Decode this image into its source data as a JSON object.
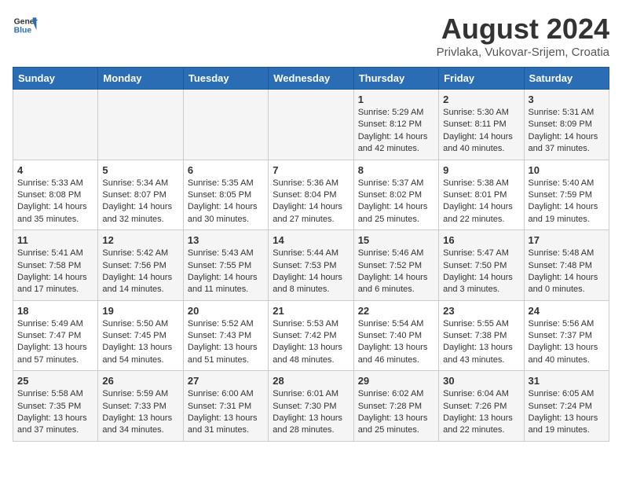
{
  "logo": {
    "text_general": "General",
    "text_blue": "Blue"
  },
  "title": "August 2024",
  "subtitle": "Privlaka, Vukovar-Srijem, Croatia",
  "days_of_week": [
    "Sunday",
    "Monday",
    "Tuesday",
    "Wednesday",
    "Thursday",
    "Friday",
    "Saturday"
  ],
  "weeks": [
    [
      {
        "day": "",
        "info": ""
      },
      {
        "day": "",
        "info": ""
      },
      {
        "day": "",
        "info": ""
      },
      {
        "day": "",
        "info": ""
      },
      {
        "day": "1",
        "info": "Sunrise: 5:29 AM\nSunset: 8:12 PM\nDaylight: 14 hours and 42 minutes."
      },
      {
        "day": "2",
        "info": "Sunrise: 5:30 AM\nSunset: 8:11 PM\nDaylight: 14 hours and 40 minutes."
      },
      {
        "day": "3",
        "info": "Sunrise: 5:31 AM\nSunset: 8:09 PM\nDaylight: 14 hours and 37 minutes."
      }
    ],
    [
      {
        "day": "4",
        "info": "Sunrise: 5:33 AM\nSunset: 8:08 PM\nDaylight: 14 hours and 35 minutes."
      },
      {
        "day": "5",
        "info": "Sunrise: 5:34 AM\nSunset: 8:07 PM\nDaylight: 14 hours and 32 minutes."
      },
      {
        "day": "6",
        "info": "Sunrise: 5:35 AM\nSunset: 8:05 PM\nDaylight: 14 hours and 30 minutes."
      },
      {
        "day": "7",
        "info": "Sunrise: 5:36 AM\nSunset: 8:04 PM\nDaylight: 14 hours and 27 minutes."
      },
      {
        "day": "8",
        "info": "Sunrise: 5:37 AM\nSunset: 8:02 PM\nDaylight: 14 hours and 25 minutes."
      },
      {
        "day": "9",
        "info": "Sunrise: 5:38 AM\nSunset: 8:01 PM\nDaylight: 14 hours and 22 minutes."
      },
      {
        "day": "10",
        "info": "Sunrise: 5:40 AM\nSunset: 7:59 PM\nDaylight: 14 hours and 19 minutes."
      }
    ],
    [
      {
        "day": "11",
        "info": "Sunrise: 5:41 AM\nSunset: 7:58 PM\nDaylight: 14 hours and 17 minutes."
      },
      {
        "day": "12",
        "info": "Sunrise: 5:42 AM\nSunset: 7:56 PM\nDaylight: 14 hours and 14 minutes."
      },
      {
        "day": "13",
        "info": "Sunrise: 5:43 AM\nSunset: 7:55 PM\nDaylight: 14 hours and 11 minutes."
      },
      {
        "day": "14",
        "info": "Sunrise: 5:44 AM\nSunset: 7:53 PM\nDaylight: 14 hours and 8 minutes."
      },
      {
        "day": "15",
        "info": "Sunrise: 5:46 AM\nSunset: 7:52 PM\nDaylight: 14 hours and 6 minutes."
      },
      {
        "day": "16",
        "info": "Sunrise: 5:47 AM\nSunset: 7:50 PM\nDaylight: 14 hours and 3 minutes."
      },
      {
        "day": "17",
        "info": "Sunrise: 5:48 AM\nSunset: 7:48 PM\nDaylight: 14 hours and 0 minutes."
      }
    ],
    [
      {
        "day": "18",
        "info": "Sunrise: 5:49 AM\nSunset: 7:47 PM\nDaylight: 13 hours and 57 minutes."
      },
      {
        "day": "19",
        "info": "Sunrise: 5:50 AM\nSunset: 7:45 PM\nDaylight: 13 hours and 54 minutes."
      },
      {
        "day": "20",
        "info": "Sunrise: 5:52 AM\nSunset: 7:43 PM\nDaylight: 13 hours and 51 minutes."
      },
      {
        "day": "21",
        "info": "Sunrise: 5:53 AM\nSunset: 7:42 PM\nDaylight: 13 hours and 48 minutes."
      },
      {
        "day": "22",
        "info": "Sunrise: 5:54 AM\nSunset: 7:40 PM\nDaylight: 13 hours and 46 minutes."
      },
      {
        "day": "23",
        "info": "Sunrise: 5:55 AM\nSunset: 7:38 PM\nDaylight: 13 hours and 43 minutes."
      },
      {
        "day": "24",
        "info": "Sunrise: 5:56 AM\nSunset: 7:37 PM\nDaylight: 13 hours and 40 minutes."
      }
    ],
    [
      {
        "day": "25",
        "info": "Sunrise: 5:58 AM\nSunset: 7:35 PM\nDaylight: 13 hours and 37 minutes."
      },
      {
        "day": "26",
        "info": "Sunrise: 5:59 AM\nSunset: 7:33 PM\nDaylight: 13 hours and 34 minutes."
      },
      {
        "day": "27",
        "info": "Sunrise: 6:00 AM\nSunset: 7:31 PM\nDaylight: 13 hours and 31 minutes."
      },
      {
        "day": "28",
        "info": "Sunrise: 6:01 AM\nSunset: 7:30 PM\nDaylight: 13 hours and 28 minutes."
      },
      {
        "day": "29",
        "info": "Sunrise: 6:02 AM\nSunset: 7:28 PM\nDaylight: 13 hours and 25 minutes."
      },
      {
        "day": "30",
        "info": "Sunrise: 6:04 AM\nSunset: 7:26 PM\nDaylight: 13 hours and 22 minutes."
      },
      {
        "day": "31",
        "info": "Sunrise: 6:05 AM\nSunset: 7:24 PM\nDaylight: 13 hours and 19 minutes."
      }
    ]
  ]
}
